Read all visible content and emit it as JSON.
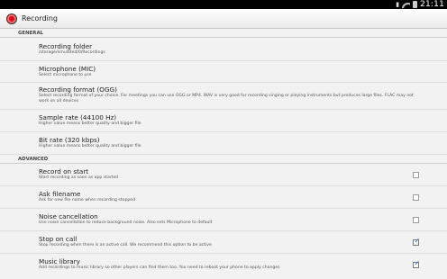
{
  "statusbar": {
    "time": "21:11"
  },
  "actionbar": {
    "title": "Recording"
  },
  "sections": {
    "general": "GENERAL",
    "advanced": "ADVANCED"
  },
  "general": [
    {
      "title": "Recording folder",
      "summary": "/storage/emulated/0/Recordings"
    },
    {
      "title": "Microphone (MIC)",
      "summary": "Select microphone to use"
    },
    {
      "title": "Recording format (OGG)",
      "summary": "Select recording format of your choice. For meetings you can use OGG or MP4. WAV is very good for recording singing or playing instruments but produces large files. FLAC may not work on all devices"
    },
    {
      "title": "Sample rate (44100 Hz)",
      "summary": "Higher value means better quality and bigger file"
    },
    {
      "title": "Bit rate (320 kbps)",
      "summary": "Higher value means better quality and bigger file"
    }
  ],
  "advanced": [
    {
      "title": "Record on start",
      "summary": "Start recording as soon as app started",
      "checked": false
    },
    {
      "title": "Ask filename",
      "summary": "Ask for new file name when recording stopped",
      "checked": false
    },
    {
      "title": "Noise cancellation",
      "summary": "Use noise cancellation to reduce background noise. Also sets Microphone to default",
      "checked": false
    },
    {
      "title": "Stop on call",
      "summary": "Stop recording when there is an active call. We recommend this option to be active",
      "checked": true
    },
    {
      "title": "Music library",
      "summary": "Add recordings to music library so other players can find them too. You need to reboot your phone to apply changes",
      "checked": true
    }
  ],
  "colors": {
    "accent": "#1e7ad8",
    "app_icon": "#d50a1e",
    "statusbar": "#000000"
  },
  "icons": [
    "app-record-icon",
    "wifi-icon",
    "battery-icon",
    "notification-icon",
    "check-icon"
  ]
}
